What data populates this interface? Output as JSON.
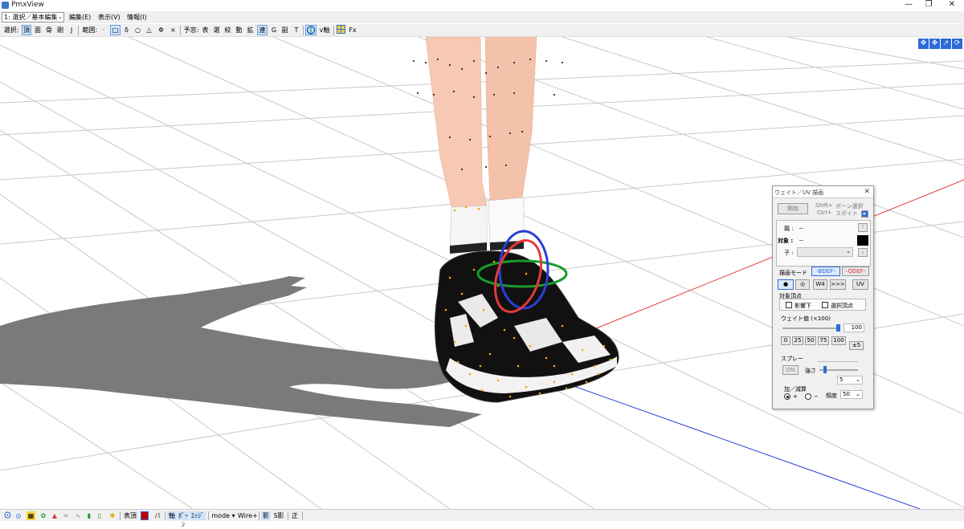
{
  "window": {
    "title": "PmxView",
    "minimize": "—",
    "maximize": "❐",
    "close": "✕"
  },
  "menubar": {
    "mode_select": "1: 選択／基本編集",
    "menus": [
      "編集(E)",
      "表示(V)",
      "情報(I)"
    ]
  },
  "toolbar": {
    "select_label": "選択:",
    "select_items": [
      "頂",
      "面",
      "骨",
      "剛",
      "J"
    ],
    "range_label": "範囲:",
    "range_items": [
      "·",
      "□",
      "δ",
      "○",
      "△",
      "Φ",
      "×"
    ],
    "lock_label": "予窓:",
    "lock_items": [
      "表",
      "選",
      "絞",
      "動",
      "拡",
      "連",
      "G",
      "副",
      "T"
    ],
    "axis_label": "v軸",
    "fx_label": "Fx"
  },
  "view_icons": [
    "✥",
    "✥",
    "↗",
    "⟳"
  ],
  "weight_panel": {
    "title": "ウェイト／UV 描画",
    "start_button": "開始",
    "shift_hint": "Shift+",
    "ctrl_hint": "Ctrl+",
    "bone_select": "ボーン選択",
    "bone_sample": "スポイト",
    "parent_label": "親 :",
    "parent_value": "－",
    "target_label": "対象 :",
    "target_value": "－",
    "child_label": "子 :",
    "draw_mode_label": "描画モード",
    "bdef_button": "-BDEF-",
    "qdef_button": "-QDEF-",
    "tool_buttons": [
      "●",
      "◎",
      "W4",
      ">>>",
      "UV"
    ],
    "target_vertex_label": "対象頂点",
    "shadow_label": "影響下",
    "selected_vertex_label": "選択頂点",
    "weight_label": "ウェイト値 (×100)",
    "weight_value": "100",
    "weight_presets": [
      "0",
      "25",
      "50",
      "75",
      "100"
    ],
    "plusminus_button": "±5",
    "spray_label": "スプレー",
    "spray_on": "ON",
    "strength_label": "強さ",
    "strength_value": "5",
    "addsub_label": "加／減算",
    "plus_label": "+",
    "minus_label": "−",
    "frequency_label": "頻度",
    "frequency_value": "50"
  },
  "statusbar": {
    "items": [
      "表頂",
      "ﾉﾐ",
      "軸",
      "ﾎﾞｰﾝ",
      "ｴｯｼﾞ",
      "mode ▾",
      "Wire+",
      "影",
      "S影",
      "正"
    ]
  },
  "colors": {
    "accent": "#2c6bd6",
    "axis_x": "#e23b3b",
    "axis_y": "#1a9a2a",
    "axis_z": "#2b3fd8",
    "vertex_orange": "#f5a21a"
  }
}
